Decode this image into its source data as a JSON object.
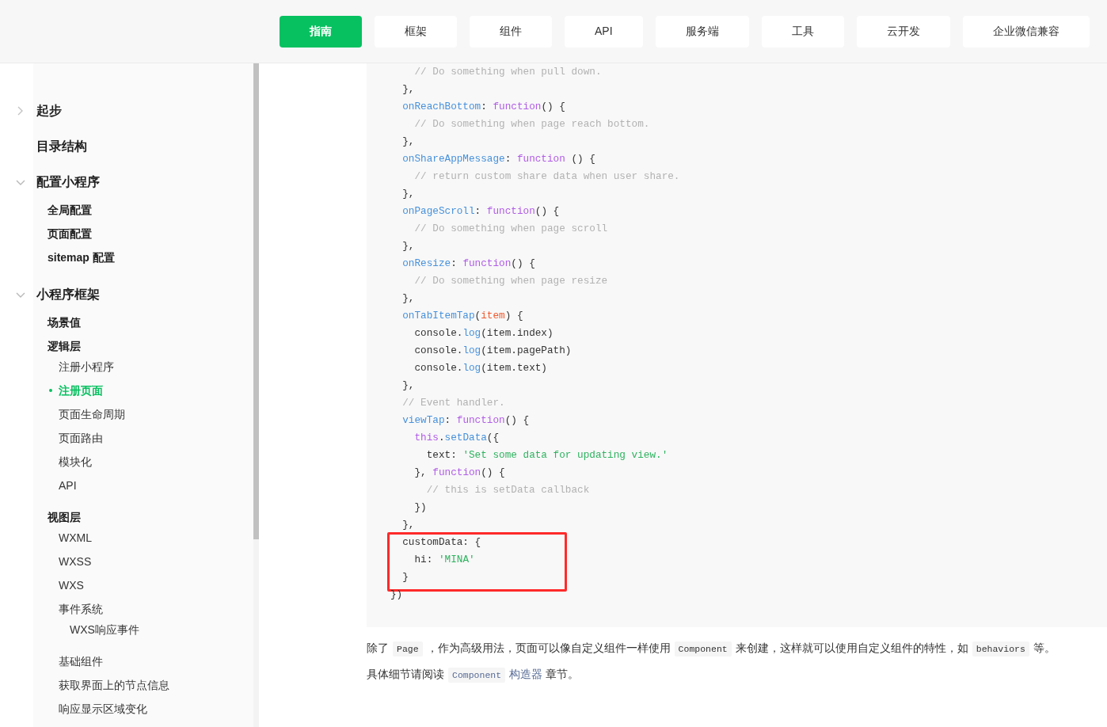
{
  "nav": {
    "tabs": [
      {
        "label": "指南",
        "selected": true
      },
      {
        "label": "框架",
        "selected": false
      },
      {
        "label": "组件",
        "selected": false
      },
      {
        "label": "API",
        "selected": false
      },
      {
        "label": "服务端",
        "selected": false
      },
      {
        "label": "工具",
        "selected": false
      },
      {
        "label": "云开发",
        "selected": false
      },
      {
        "label": "企业微信兼容",
        "selected": false
      }
    ]
  },
  "sidebar": {
    "items": [
      {
        "label": "起步",
        "kind": "section",
        "expanded": false,
        "selected": false
      },
      {
        "label": "目录结构",
        "kind": "page",
        "selected": false
      },
      {
        "label": "配置小程序",
        "kind": "section",
        "expanded": true,
        "selected": false,
        "children": [
          {
            "label": "全局配置",
            "selected": false
          },
          {
            "label": "页面配置",
            "selected": false
          },
          {
            "label": "sitemap 配置",
            "selected": false
          }
        ]
      },
      {
        "label": "小程序框架",
        "kind": "section",
        "expanded": true,
        "selected": false,
        "children": [
          {
            "label": "场景值",
            "selected": false
          },
          {
            "label": "逻辑层",
            "selected": false,
            "children": [
              {
                "label": "注册小程序",
                "selected": false
              },
              {
                "label": "注册页面",
                "selected": true
              },
              {
                "label": "页面生命周期",
                "selected": false
              },
              {
                "label": "页面路由",
                "selected": false
              },
              {
                "label": "模块化",
                "selected": false
              },
              {
                "label": "API",
                "selected": false
              }
            ]
          },
          {
            "label": "视图层",
            "selected": false,
            "children": [
              {
                "label": "WXML",
                "selected": false
              },
              {
                "label": "WXSS",
                "selected": false
              },
              {
                "label": "WXS",
                "selected": false
              },
              {
                "label": "事件系统",
                "selected": false,
                "children": [
                  {
                    "label": "WXS响应事件",
                    "selected": false
                  }
                ]
              },
              {
                "label": "基础组件",
                "selected": false
              },
              {
                "label": "获取界面上的节点信息",
                "selected": false
              },
              {
                "label": "响应显示区域变化",
                "selected": false
              }
            ]
          }
        ]
      }
    ]
  },
  "code": {
    "sections": [
      {
        "highlighted": false,
        "lines": [
          [
            {
              "text": "    // Do something when pull down.",
              "kind": "comment"
            }
          ],
          [
            {
              "text": "  },",
              "kind": "plain"
            }
          ],
          [
            {
              "text": "  onReachBottom",
              "kind": "name"
            },
            {
              "text": ": ",
              "kind": "plain"
            },
            {
              "text": "function",
              "kind": "keyword"
            },
            {
              "text": "() {",
              "kind": "plain"
            }
          ],
          [
            {
              "text": "    // Do something when page reach bottom.",
              "kind": "comment"
            }
          ],
          [
            {
              "text": "  },",
              "kind": "plain"
            }
          ],
          [
            {
              "text": "  onShareAppMessage",
              "kind": "name"
            },
            {
              "text": ": ",
              "kind": "plain"
            },
            {
              "text": "function",
              "kind": "keyword"
            },
            {
              "text": " () {",
              "kind": "plain"
            }
          ],
          [
            {
              "text": "    // return custom share data when user share.",
              "kind": "comment"
            }
          ],
          [
            {
              "text": "  },",
              "kind": "plain"
            }
          ],
          [
            {
              "text": "  onPageScroll",
              "kind": "name"
            },
            {
              "text": ": ",
              "kind": "plain"
            },
            {
              "text": "function",
              "kind": "keyword"
            },
            {
              "text": "() {",
              "kind": "plain"
            }
          ],
          [
            {
              "text": "    // Do something when page scroll",
              "kind": "comment"
            }
          ],
          [
            {
              "text": "  },",
              "kind": "plain"
            }
          ],
          [
            {
              "text": "  onResize",
              "kind": "name"
            },
            {
              "text": ": ",
              "kind": "plain"
            },
            {
              "text": "function",
              "kind": "keyword"
            },
            {
              "text": "() {",
              "kind": "plain"
            }
          ],
          [
            {
              "text": "    // Do something when page resize",
              "kind": "comment"
            }
          ],
          [
            {
              "text": "  },",
              "kind": "plain"
            }
          ],
          [
            {
              "text": "  onTabItemTap",
              "kind": "name"
            },
            {
              "text": "(",
              "kind": "plain"
            },
            {
              "text": "item",
              "kind": "param"
            },
            {
              "text": ") {",
              "kind": "plain"
            }
          ],
          [
            {
              "text": "    console.",
              "kind": "plain"
            },
            {
              "text": "log",
              "kind": "name"
            },
            {
              "text": "(item.index)",
              "kind": "plain"
            }
          ],
          [
            {
              "text": "    console.",
              "kind": "plain"
            },
            {
              "text": "log",
              "kind": "name"
            },
            {
              "text": "(item.pagePath)",
              "kind": "plain"
            }
          ],
          [
            {
              "text": "    console.",
              "kind": "plain"
            },
            {
              "text": "log",
              "kind": "name"
            },
            {
              "text": "(item.text)",
              "kind": "plain"
            }
          ],
          [
            {
              "text": "  },",
              "kind": "plain"
            }
          ],
          [
            {
              "text": "  // Event handler.",
              "kind": "comment"
            }
          ],
          [
            {
              "text": "  viewTap",
              "kind": "name"
            },
            {
              "text": ": ",
              "kind": "plain"
            },
            {
              "text": "function",
              "kind": "keyword"
            },
            {
              "text": "() {",
              "kind": "plain"
            }
          ],
          [
            {
              "text": "    this",
              "kind": "keyword"
            },
            {
              "text": ".",
              "kind": "plain"
            },
            {
              "text": "setData",
              "kind": "name"
            },
            {
              "text": "({",
              "kind": "plain"
            }
          ],
          [
            {
              "text": "      text: ",
              "kind": "plain"
            },
            {
              "text": "'Set some data for updating view.'",
              "kind": "string"
            }
          ],
          [
            {
              "text": "    }, ",
              "kind": "plain"
            },
            {
              "text": "function",
              "kind": "keyword"
            },
            {
              "text": "() {",
              "kind": "plain"
            }
          ],
          [
            {
              "text": "      // this is setData callback",
              "kind": "comment"
            }
          ],
          [
            {
              "text": "    })",
              "kind": "plain"
            }
          ],
          [
            {
              "text": "  },",
              "kind": "plain"
            }
          ]
        ]
      },
      {
        "highlighted": true,
        "lines": [
          [
            {
              "text": "  customData: {",
              "kind": "plain"
            }
          ],
          [
            {
              "text": "    hi: ",
              "kind": "plain"
            },
            {
              "text": "'MINA'",
              "kind": "string"
            }
          ],
          [
            {
              "text": "  }",
              "kind": "plain"
            }
          ]
        ]
      },
      {
        "highlighted": false,
        "lines": [
          [
            {
              "text": "})",
              "kind": "plain"
            }
          ]
        ]
      }
    ]
  },
  "paragraphs": [
    {
      "parts": [
        {
          "kind": "text",
          "text": "除了"
        },
        {
          "kind": "code",
          "text": "Page"
        },
        {
          "kind": "text",
          "text": "，作为高级用法，页面可以像自定义组件一样使用"
        },
        {
          "kind": "code",
          "text": "Component"
        },
        {
          "kind": "text",
          "text": "来创建，这样就可以使用自定义组件的特性，如"
        },
        {
          "kind": "code",
          "text": "behaviors"
        },
        {
          "kind": "text",
          "text": "等。"
        }
      ]
    },
    {
      "parts": [
        {
          "kind": "text",
          "text": "具体细节请阅读"
        },
        {
          "kind": "link",
          "parts": [
            {
              "kind": "code",
              "text": "Component"
            },
            {
              "kind": "text",
              "text": "构造器"
            }
          ]
        },
        {
          "kind": "text",
          "text": "章节。"
        }
      ]
    }
  ]
}
